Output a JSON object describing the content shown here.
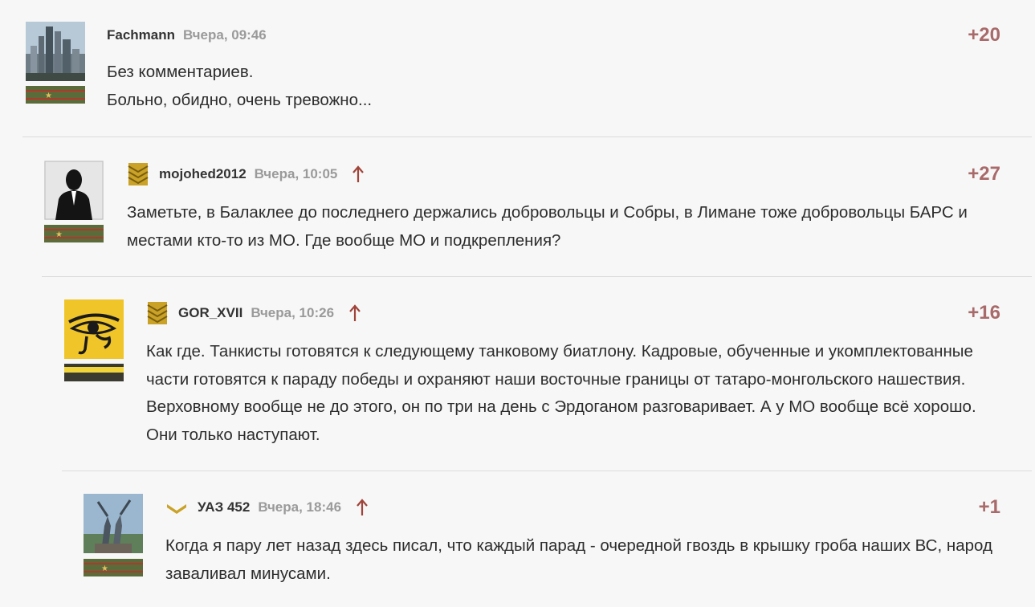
{
  "comments": [
    {
      "author": "Fachmann",
      "time": "Вчера, 09:46",
      "score": "+20",
      "avatar_icon": "city-skyline-avatar",
      "lines": [
        "Без комментариев.",
        "Больно, обидно, очень тревожно..."
      ]
    },
    {
      "author": "mojohed2012",
      "time": "Вчера, 10:05",
      "score": "+27",
      "avatar_icon": "suit-silhouette-avatar",
      "lines": [
        "Заметьте, в Балаклее до последнего держались добровольцы и Собры, в Лимане тоже добровольцы БАРС и местами кто-то из МО. Где вообще МО и подкрепления?"
      ]
    },
    {
      "author": "GOR_XVII",
      "time": "Вчера, 10:26",
      "score": "+16",
      "avatar_icon": "eye-of-horus-avatar",
      "lines": [
        "Как где. Танкисты готовятся к следующему танковому биатлону. Кадровые, обученные и укомплектованные части готовятся к параду победы и охраняют наши восточные границы от татаро-монгольского нашествия. Верховному вообще не до этого, он по три на день с Эрдоганом разговаривает. А у МО вообще всё хорошо. Они только наступают."
      ]
    },
    {
      "author": "УАЗ 452",
      "time": "Вчера, 18:46",
      "score": "+1",
      "avatar_icon": "monument-avatar",
      "lines": [
        "Когда я пару лет назад здесь писал, что каждый парад - очередной гвоздь в крышку гроба наших ВС, народ заваливал минусами."
      ]
    }
  ],
  "colors": {
    "score": "#a86a6a",
    "reply_arrow": "#a0443a",
    "time": "#9a9a9a",
    "chevron": "#c9a227"
  }
}
